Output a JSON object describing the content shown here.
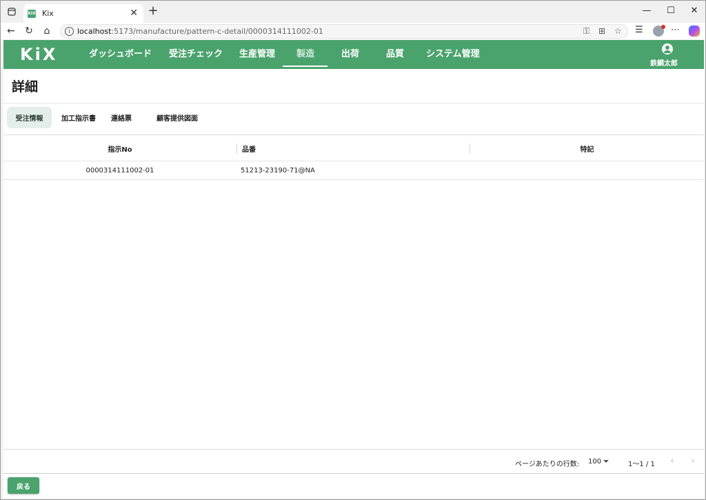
{
  "browser": {
    "tab_title": "Kix",
    "favicon_text": "KIX",
    "url_host": "localhost",
    "url_path": ":5173/manufacture/pattern-c-detail/0000314111002-01"
  },
  "app": {
    "logo": "KiX",
    "brand_color": "#4aa36d",
    "nav": [
      {
        "label": "ダッシュボード"
      },
      {
        "label": "受注チェック"
      },
      {
        "label": "生産管理"
      },
      {
        "label": "製造"
      },
      {
        "label": "出荷"
      },
      {
        "label": "品質"
      },
      {
        "label": "システム管理"
      }
    ],
    "active_nav": "製造",
    "user_name": "鉄鋼太郎"
  },
  "page": {
    "title": "詳細",
    "tabs": [
      {
        "label": "受注情報"
      },
      {
        "label": "加工指示書"
      },
      {
        "label": "連絡票"
      },
      {
        "label": "顧客提供図面"
      }
    ],
    "active_tab": "受注情報"
  },
  "table": {
    "columns": [
      "指示No",
      "品番",
      "特記"
    ],
    "rows": [
      [
        "0000314111002-01",
        "51213-23190-71@NA",
        ""
      ]
    ]
  },
  "pagination": {
    "rows_per_page_label": "ページあたりの行数:",
    "rows_per_page": "100",
    "range": "1〜1 / 1"
  },
  "actions": {
    "back_label": "戻る"
  }
}
